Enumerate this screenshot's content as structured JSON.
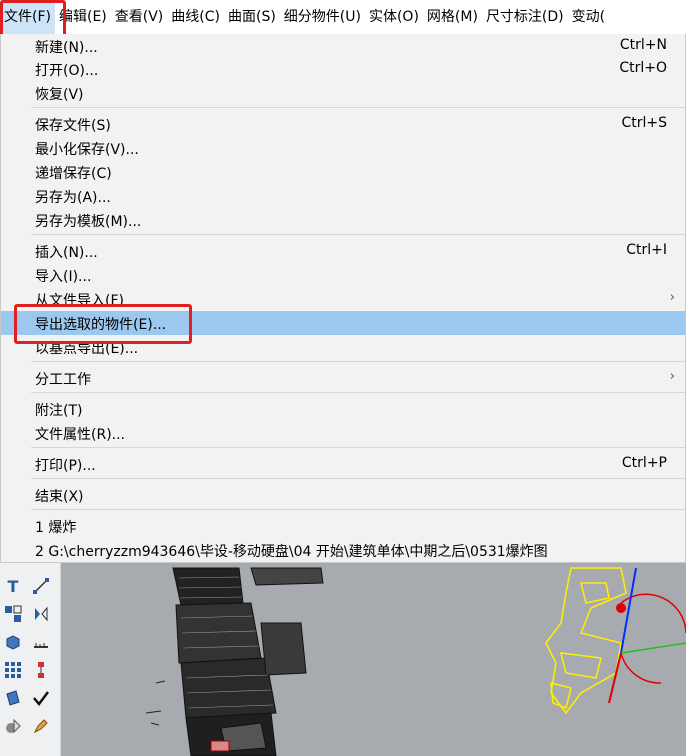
{
  "menubar": {
    "items": [
      "文件(F)",
      "编辑(E)",
      "查看(V)",
      "曲线(C)",
      "曲面(S)",
      "细分物件(U)",
      "实体(O)",
      "网格(M)",
      "尺寸标注(D)",
      "变动("
    ]
  },
  "file_menu": {
    "new": {
      "label": "新建(N)...",
      "shortcut": "Ctrl+N"
    },
    "open": {
      "label": "打开(O)...",
      "shortcut": "Ctrl+O"
    },
    "revert": {
      "label": "恢复(V)"
    },
    "save": {
      "label": "保存文件(S)",
      "shortcut": "Ctrl+S"
    },
    "save_small": {
      "label": "最小化保存(V)..."
    },
    "save_incremental": {
      "label": "递增保存(C)"
    },
    "save_as": {
      "label": "另存为(A)..."
    },
    "save_as_template": {
      "label": "另存为模板(M)..."
    },
    "insert": {
      "label": "插入(N)...",
      "shortcut": "Ctrl+I"
    },
    "import": {
      "label": "导入(I)..."
    },
    "import_from_file": {
      "label": "从文件导入(F)"
    },
    "export_selected": {
      "label": "导出选取的物件(E)..."
    },
    "export_with_origin": {
      "label": "以基点导出(E)..."
    },
    "worksession": {
      "label": "分工工作"
    },
    "notes": {
      "label": "附注(T)"
    },
    "properties": {
      "label": "文件属性(R)..."
    },
    "print": {
      "label": "打印(P)...",
      "shortcut": "Ctrl+P"
    },
    "exit": {
      "label": "结束(X)"
    },
    "recent_1": {
      "label": "1 爆炸"
    },
    "recent_2": {
      "label": "2 G:\\cherryzzm943646\\毕设-移动硬盘\\04 开始\\建筑单体\\中期之后\\0531爆炸图"
    }
  },
  "colors": {
    "highlight_box": "#e02020",
    "selected_item": "#9cc7ef",
    "viewport_bg": "#a7abaf"
  }
}
